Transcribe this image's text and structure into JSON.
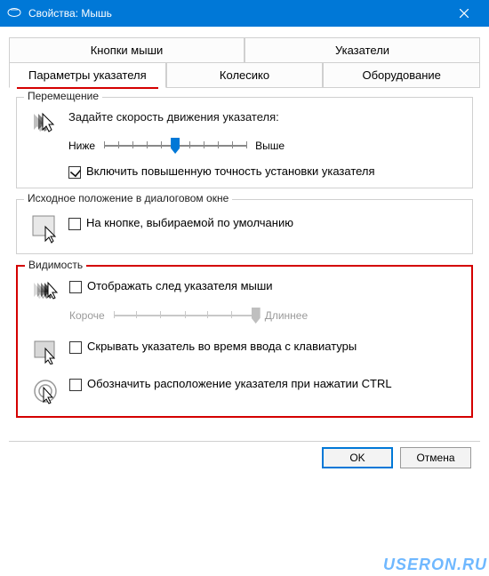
{
  "titlebar": {
    "title": "Свойства: Мышь"
  },
  "tabs": {
    "row1": [
      {
        "label": "Кнопки мыши"
      },
      {
        "label": "Указатели"
      }
    ],
    "row2": [
      {
        "label": "Параметры указателя",
        "active": true
      },
      {
        "label": "Колесико"
      },
      {
        "label": "Оборудование"
      }
    ]
  },
  "groups": {
    "motion": {
      "legend": "Перемещение",
      "speed_label": "Задайте скорость движения указателя:",
      "slow": "Ниже",
      "fast": "Выше",
      "precision": "Включить повышенную точность установки указателя"
    },
    "snap": {
      "legend": "Исходное положение в диалоговом окне",
      "option": "На кнопке, выбираемой по умолчанию"
    },
    "visibility": {
      "legend": "Видимость",
      "trails": "Отображать след указателя мыши",
      "short": "Короче",
      "long": "Длиннее",
      "hide": "Скрывать указатель во время ввода с клавиатуры",
      "ctrl": "Обозначить расположение указателя при нажатии CTRL"
    }
  },
  "buttons": {
    "ok": "OK",
    "cancel": "Отмена"
  },
  "watermark": "USERON.RU"
}
